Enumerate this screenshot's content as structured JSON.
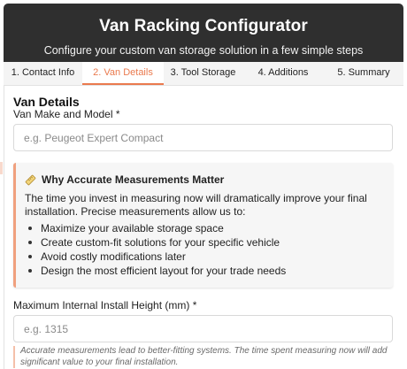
{
  "header": {
    "title": "Van Racking Configurator",
    "subtitle": "Configure your custom van storage solution in a few simple steps"
  },
  "tabs": [
    {
      "label": "1. Contact Info",
      "active": false
    },
    {
      "label": "2. Van Details",
      "active": true
    },
    {
      "label": "3. Tool Storage",
      "active": false
    },
    {
      "label": "4. Additions",
      "active": false
    },
    {
      "label": "5. Summary",
      "active": false
    }
  ],
  "section": {
    "title": "Van Details"
  },
  "make_field": {
    "label": "Van Make and Model *",
    "placeholder": "e.g. Peugeot Expert Compact",
    "value": ""
  },
  "info": {
    "icon": "ruler-icon",
    "heading": "Why Accurate Measurements Matter",
    "body": "The time you invest in measuring now will dramatically improve your final installation. Precise measurements allow us to:",
    "bullets": [
      "Maximize your available storage space",
      "Create custom-fit solutions for your specific vehicle",
      "Avoid costly modifications later",
      "Design the most efficient layout for your trade needs"
    ]
  },
  "height_field": {
    "label": "Maximum Internal Install Height (mm) *",
    "placeholder": "e.g. 1315",
    "value": ""
  },
  "hint": "Accurate measurements lead to better-fitting systems. The time spent measuring now will add significant value to your final installation.",
  "colors": {
    "header_bg": "#2f2f2f",
    "accent": "#ea7a4e",
    "info_border": "#f0a07e"
  }
}
